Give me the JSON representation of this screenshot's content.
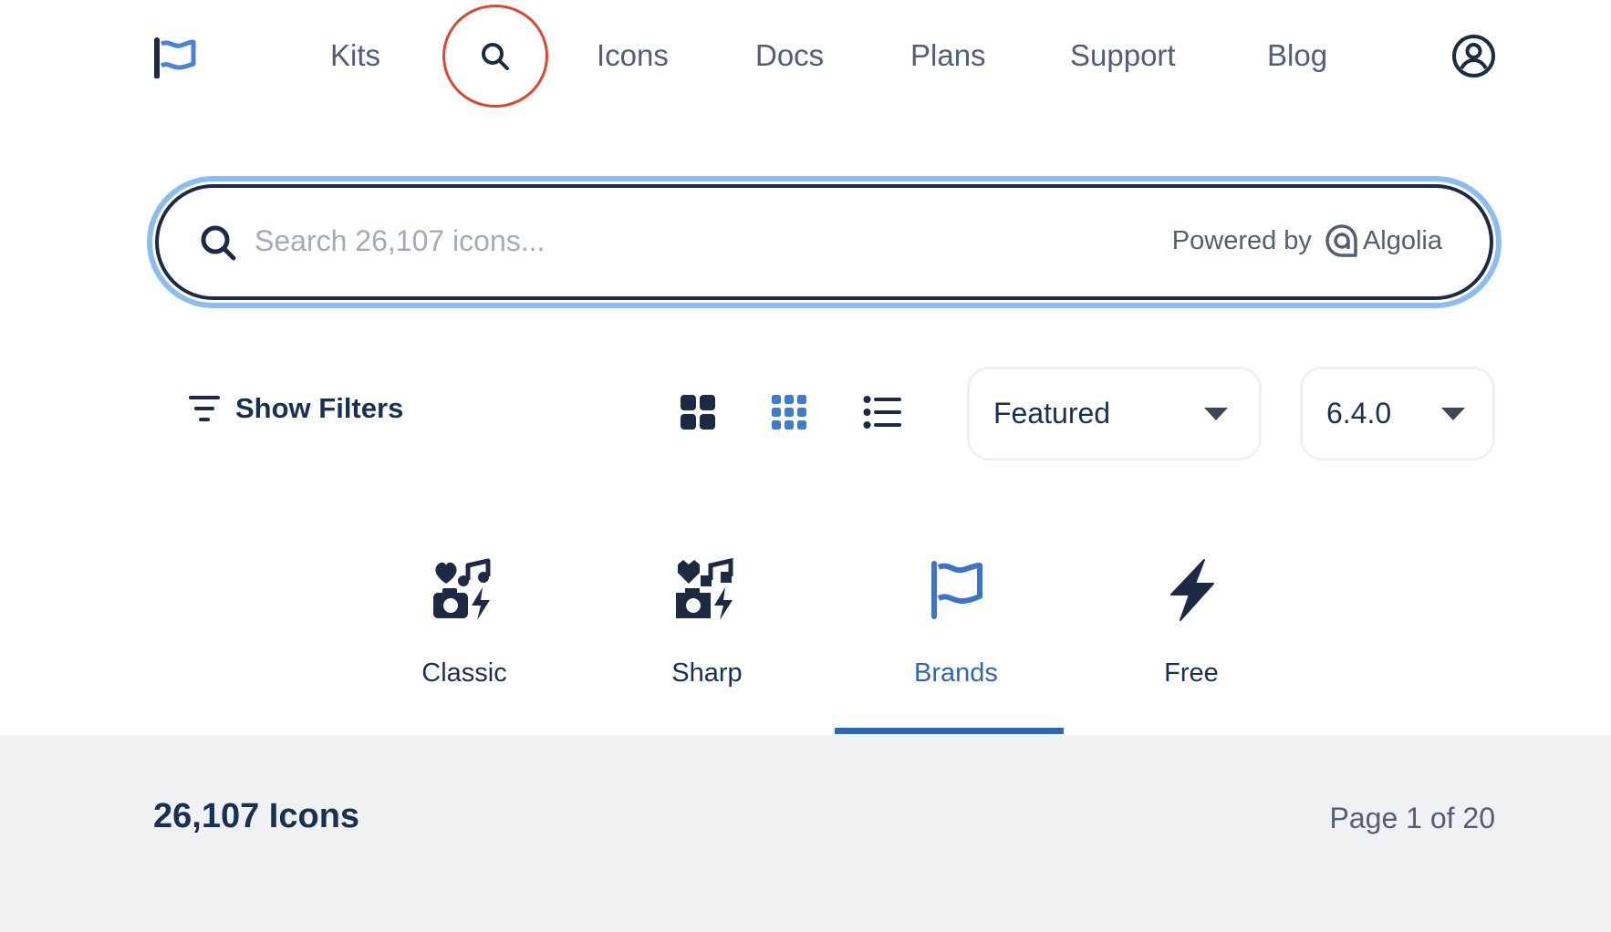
{
  "nav": {
    "items": [
      "Kits",
      "Icons",
      "Docs",
      "Plans",
      "Support",
      "Blog"
    ],
    "logo_icon": "flag-icon",
    "search_icon": "search-icon",
    "account_icon": "user-circle-icon",
    "search_highlight_color": "#e0452d"
  },
  "search": {
    "placeholder": "Search 26,107 icons...",
    "value": "",
    "powered_by": "Powered by",
    "provider": "Algolia",
    "focus_color": "#8dbcf0"
  },
  "controls": {
    "filters_label": "Show Filters",
    "view_modes": [
      "grid-large-icon",
      "grid-small-icon",
      "list-icon"
    ],
    "active_view": "grid-small-icon",
    "sort": {
      "selected": "Featured"
    },
    "version": {
      "selected": "6.4.0"
    }
  },
  "families": {
    "tabs": [
      {
        "label": "Classic",
        "icon": "classic-icons-icon"
      },
      {
        "label": "Sharp",
        "icon": "sharp-icons-icon"
      },
      {
        "label": "Brands",
        "icon": "flag-icon"
      },
      {
        "label": "Free",
        "icon": "bolt-icon"
      }
    ],
    "active": "Brands",
    "accent_color": "#2e66b8"
  },
  "results": {
    "count": "26,107 Icons",
    "page": "Page 1 of 20"
  }
}
